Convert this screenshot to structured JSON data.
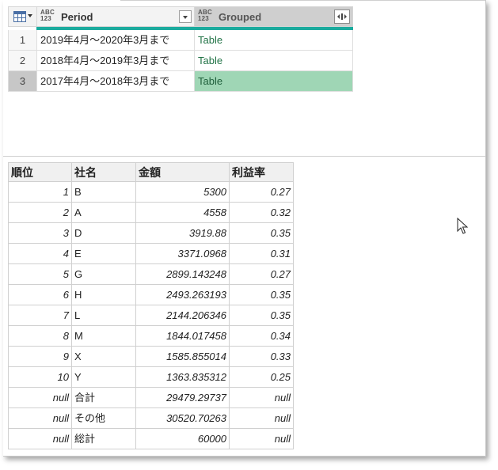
{
  "top_grid": {
    "columns": [
      {
        "type_top": "ABC",
        "type_bottom": "123",
        "name": "Period"
      },
      {
        "type_top": "ABC",
        "type_bottom": "123",
        "name": "Grouped"
      }
    ],
    "rows": [
      {
        "num": "1",
        "period": "2019年4月～2020年3月まで",
        "grouped": "Table"
      },
      {
        "num": "2",
        "period": "2018年4月～2019年3月まで",
        "grouped": "Table"
      },
      {
        "num": "3",
        "period": "2017年4月～2018年3月まで",
        "grouped": "Table"
      }
    ],
    "selected_row": 3,
    "accent_color": "#1bab9e",
    "selected_color": "#9fd6b5"
  },
  "preview_table": {
    "headers": [
      "順位",
      "社名",
      "金額",
      "利益率"
    ],
    "rows": [
      [
        "1",
        "B",
        "5300",
        "0.27"
      ],
      [
        "2",
        "A",
        "4558",
        "0.32"
      ],
      [
        "3",
        "D",
        "3919.88",
        "0.35"
      ],
      [
        "4",
        "E",
        "3371.0968",
        "0.31"
      ],
      [
        "5",
        "G",
        "2899.143248",
        "0.27"
      ],
      [
        "6",
        "H",
        "2493.263193",
        "0.35"
      ],
      [
        "7",
        "L",
        "2144.206346",
        "0.35"
      ],
      [
        "8",
        "M",
        "1844.017458",
        "0.34"
      ],
      [
        "9",
        "X",
        "1585.855014",
        "0.33"
      ],
      [
        "10",
        "Y",
        "1363.835312",
        "0.25"
      ],
      [
        "null",
        "合計",
        "29479.29737",
        "null"
      ],
      [
        "null",
        "その他",
        "30520.70263",
        "null"
      ],
      [
        "null",
        "総計",
        "60000",
        "null"
      ]
    ]
  },
  "icons": {
    "table_menu": "table-icon",
    "period_filter": "chevron-down-icon",
    "grouped_expand": "expand-columns-icon",
    "cursor": "mouse-pointer-icon"
  }
}
